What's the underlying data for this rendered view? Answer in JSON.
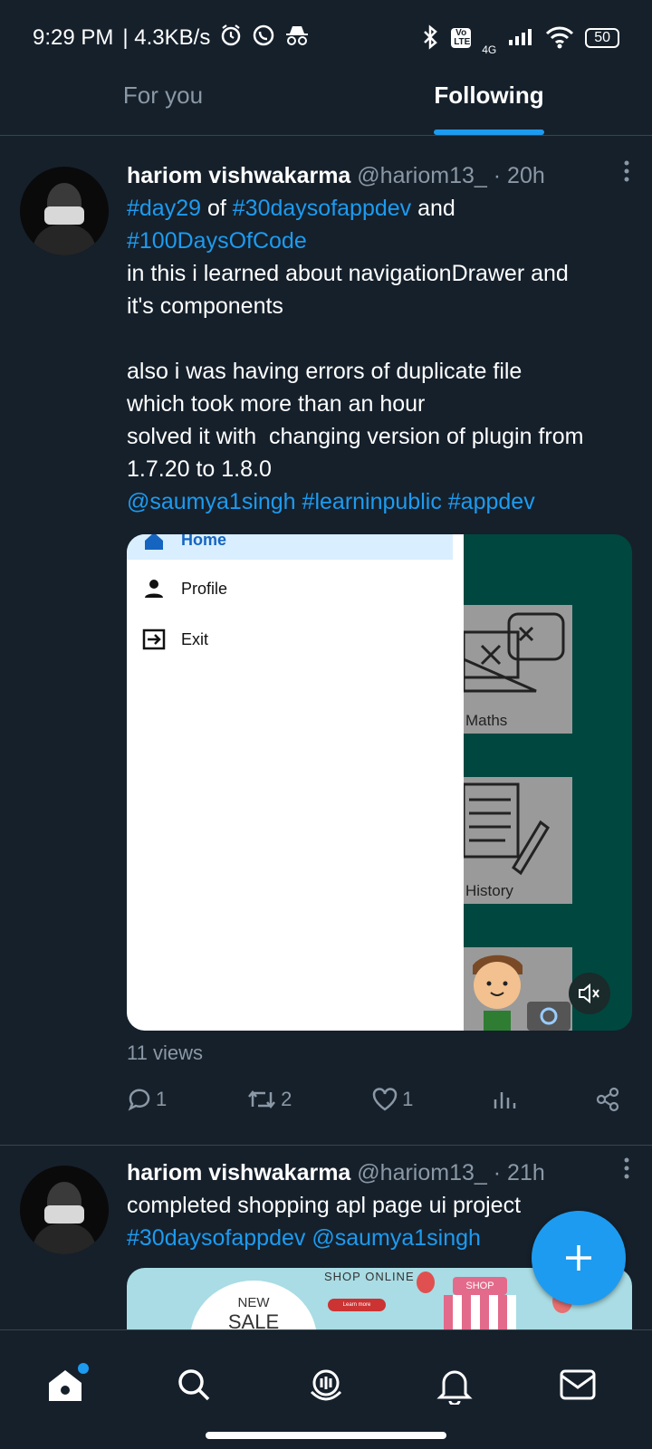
{
  "status_bar": {
    "time": "9:29 PM",
    "speed": "| 4.3KB/s",
    "network_badge": "Vo LTE",
    "signal_label": "4G",
    "battery": "50"
  },
  "tabs": [
    {
      "label": "For you",
      "active": false
    },
    {
      "label": "Following",
      "active": true
    }
  ],
  "tweets": [
    {
      "author_name": "hariom vishwakarma",
      "handle": "@hariom13_",
      "time": "· 20h",
      "lines": {
        "l1_tag1": "#day29",
        "l1_mid": " of ",
        "l1_tag2": "#30daysofappdev",
        "l1_end": " and",
        "l2_tag": "#100DaysOfCode",
        "l3": "in this i learned about navigationDrawer and",
        "l4": "it's components",
        "l5": "also i was having errors of duplicate file",
        "l6": "which took more than an hour",
        "l7": "solved it with  changing version of plugin from",
        "l8": "1.7.20 to 1.8.0",
        "l9_mention": "@saumya1singh",
        "l9_tag1": "#learninpublic",
        "l9_tag2": "#appdev"
      },
      "media": {
        "drawer_items": [
          "Home",
          "Profile",
          "Exit"
        ],
        "cards": [
          "Maths",
          "History"
        ]
      },
      "views": "11 views",
      "replies": "1",
      "retweets": "2",
      "likes": "1"
    },
    {
      "author_name": "hariom vishwakarma",
      "handle": "@hariom13_",
      "time": "· 21h",
      "lines": {
        "l1": "completed shopping apl page ui project",
        "l2_tag": "#30daysofappdev",
        "l2_mention": "@saumya1singh"
      },
      "media": {
        "banner_title": "SHOP ONLINE",
        "badge_new": "NEW",
        "badge_sale": "SALE",
        "button": "Learn more",
        "shop_sign": "SHOP"
      }
    }
  ],
  "colors": {
    "background": "#15202b",
    "accent": "#1d9bf0",
    "muted": "#8b98a5",
    "divider": "#38444d"
  },
  "bottom_nav": [
    "home-icon",
    "search-icon",
    "spaces-icon",
    "notifications-icon",
    "messages-icon"
  ]
}
